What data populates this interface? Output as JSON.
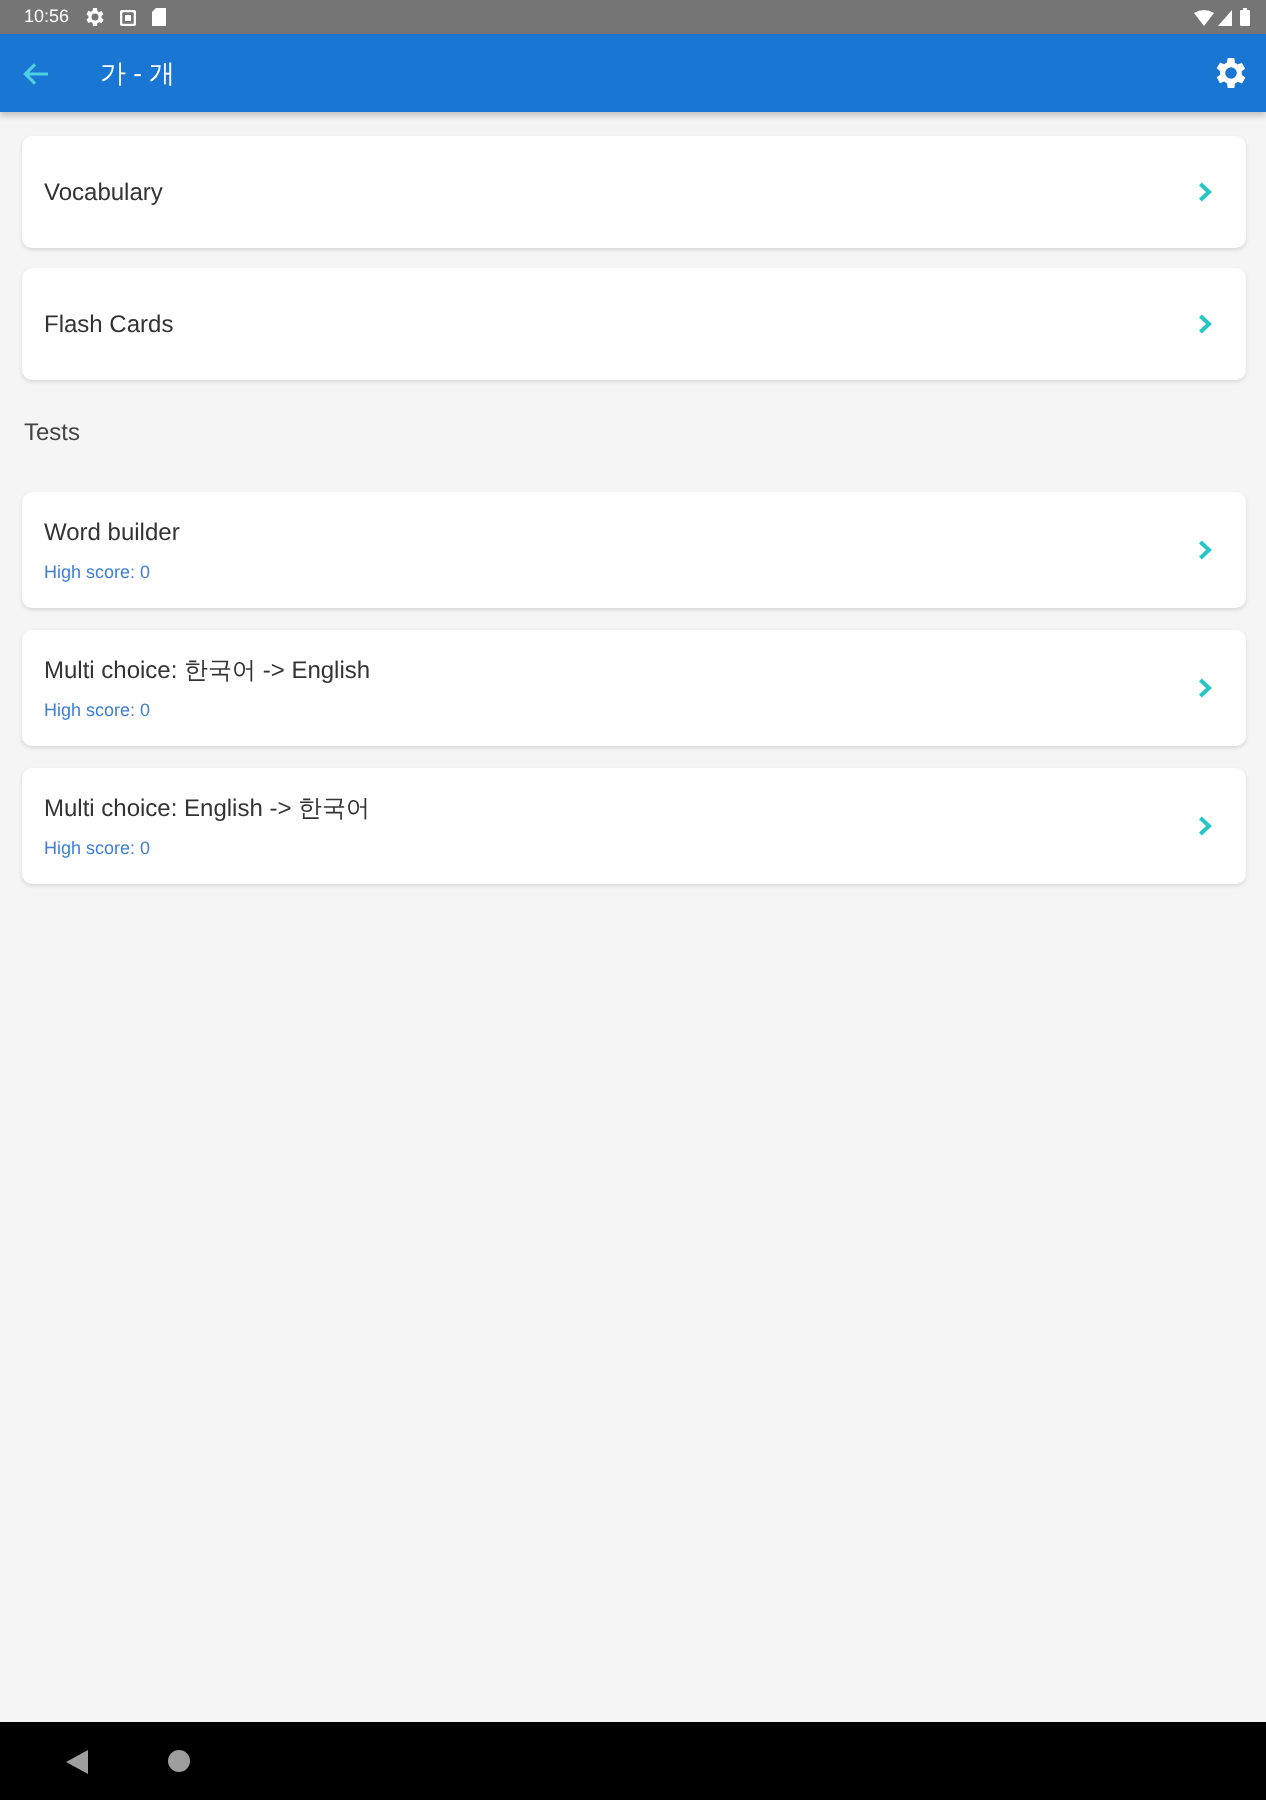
{
  "status_bar": {
    "time": "10:56"
  },
  "app_bar": {
    "title": "가 - 개"
  },
  "menu_items": [
    {
      "label": "Vocabulary"
    },
    {
      "label": "Flash Cards"
    }
  ],
  "section_title": "Tests",
  "tests": [
    {
      "label": "Word builder",
      "high_score": "High score: 0"
    },
    {
      "label": "Multi choice: 한국어 -> English",
      "high_score": "High score: 0"
    },
    {
      "label": "Multi choice: English -> 한국어",
      "high_score": "High score: 0"
    }
  ]
}
